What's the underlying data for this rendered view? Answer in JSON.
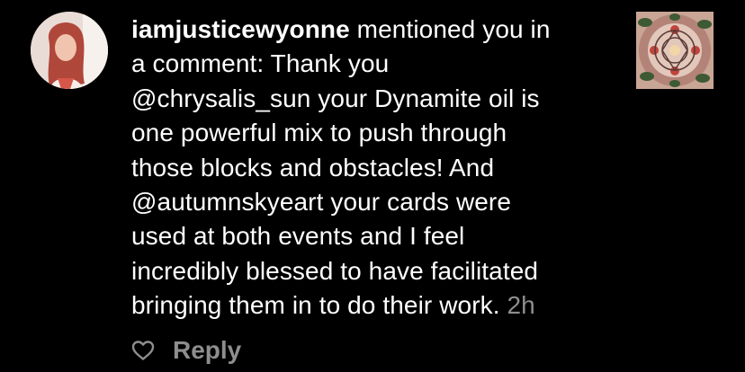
{
  "notification": {
    "username": "iamjusticewyonne",
    "lines": [
      {
        "before": "",
        "bold": "iamjusticewyonne",
        "after": " mentioned you in"
      },
      {
        "text": "a comment: Thank you"
      },
      {
        "text": "@chrysalis_sun your Dynamite oil is"
      },
      {
        "text": "one powerful mix to push through"
      },
      {
        "text": "those blocks and obstacles! And"
      },
      {
        "text": "@autumnskyeart your cards were"
      },
      {
        "text": "used at both events and I feel"
      },
      {
        "text": "incredibly blessed to have facilitated"
      },
      {
        "text_before_time": "bringing them in to do their work.",
        "time": "2h"
      }
    ],
    "avatar_icon": "profile-photo",
    "thumbnail_icon": "post-thumbnail",
    "colors": {
      "background": "#000000",
      "text": "#ffffff",
      "secondary": "#8e8e8e"
    }
  },
  "actions": {
    "like_icon": "heart-outline-icon",
    "reply_label": "Reply"
  }
}
